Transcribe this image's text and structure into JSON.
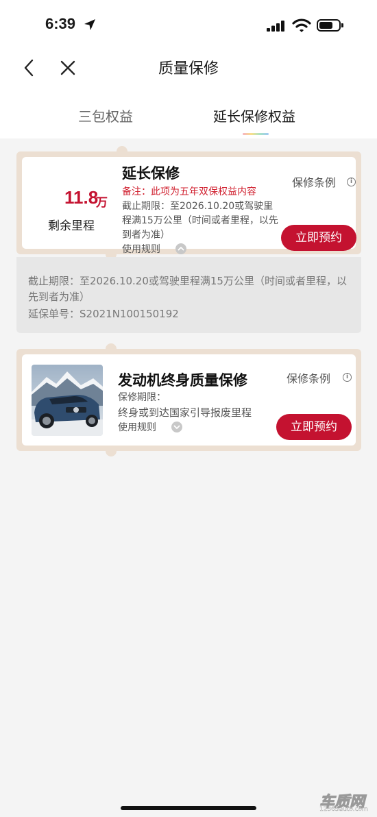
{
  "status_bar": {
    "time": "6:39"
  },
  "nav": {
    "title": "质量保修"
  },
  "tabs": [
    {
      "label": "三包权益",
      "active": false
    },
    {
      "label": "延长保修权益",
      "active": true
    }
  ],
  "extended_warranty": {
    "mileage_value": "11.8",
    "mileage_unit": "万",
    "mileage_label": "剩余里程",
    "title": "延长保修",
    "note": "备注：此项为五年双保权益内容",
    "deadline": "截止期限：至2026.10.20或驾驶里程满15万公里（时间或者里程，以先到者为准）",
    "rules_label": "使用规则",
    "terms_label": "保修条例",
    "book_label": "立即预约",
    "detail": {
      "deadline": "截止期限：至2026.10.20或驾驶里程满15万公里（时间或者里程，以先到者为准）",
      "order_no": "延保单号：S2021N100150192"
    }
  },
  "engine_warranty": {
    "title": "发动机终身质量保修",
    "period_label": "保修期限：",
    "period_value": "终身或到达国家引导报废里程",
    "rules_label": "使用规则",
    "terms_label": "保修条例",
    "book_label": "立即预约"
  },
  "watermark": {
    "logo": "车质网",
    "url": "12365auto.com"
  },
  "colors": {
    "brand_red": "#c41230",
    "card_border": "#ecdfd2",
    "note_red": "#d01f2e"
  }
}
